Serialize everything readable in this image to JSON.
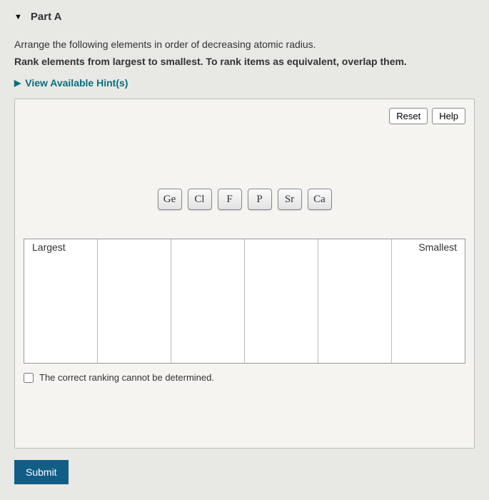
{
  "header": {
    "part_label": "Part A"
  },
  "instructions": {
    "line1": "Arrange the following elements in order of decreasing atomic radius.",
    "line2": "Rank elements from largest to smallest. To rank items as equivalent, overlap them."
  },
  "hints": {
    "label": "View Available Hint(s)"
  },
  "buttons": {
    "reset": "Reset",
    "help": "Help",
    "submit": "Submit"
  },
  "tiles": {
    "t0": "Ge",
    "t1": "Cl",
    "t2": "F",
    "t3": "P",
    "t4": "Sr",
    "t5": "Ca"
  },
  "rank": {
    "left_label": "Largest",
    "right_label": "Smallest"
  },
  "checkbox": {
    "label": "The correct ranking cannot be determined."
  }
}
